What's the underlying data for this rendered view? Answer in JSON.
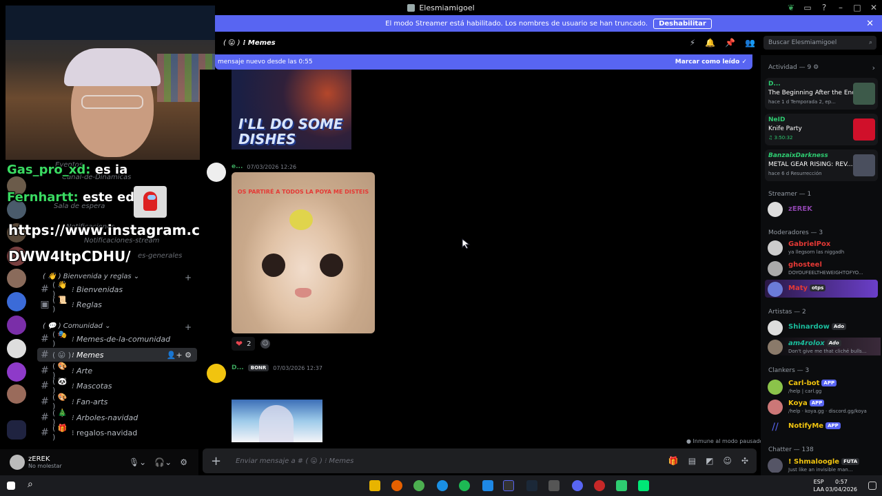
{
  "window": {
    "title": "Elesmiamigoel"
  },
  "banner": {
    "text": "El modo Streamer está habilitado. Los nombres de usuario se han truncado.",
    "button": "Deshabilitar"
  },
  "chat_header": {
    "channel_emoji": "( 😛 )",
    "channel_name": "⁝ Memes"
  },
  "search": {
    "placeholder": "Buscar Elesmiamigoel"
  },
  "newbar": {
    "text": "mensaje nuevo desde las 0:55",
    "mark_read": "Marcar como leído"
  },
  "overlay": {
    "line1_user": "Gas_pro_xd:",
    "line1_msg": " es ia",
    "line2_user": "Fernhartt:",
    "line2_msg": " este edit",
    "line3": "https://www.instagram.com/p/",
    "line4": "DWW4ItpCDHU/"
  },
  "sidebar": {
    "faded": [
      {
        "label": "Eventos"
      },
      {
        "label": "Canal-de-Dinamicas"
      },
      {
        "label": "Sala de espera"
      },
      {
        "label": "Notificaciones"
      },
      {
        "label": "Notificaciones-stream"
      },
      {
        "label": "es-generales"
      }
    ],
    "cat_bienvenida": "( 👋 ) Bienvenida y reglas ⌄",
    "cat_comunidad": "( 💬 ) Comunidad ⌄",
    "channels": [
      {
        "emoji": "( 👋 )",
        "label": "⁝ Bienvenidas"
      },
      {
        "emoji": "( 📜 )",
        "label": "⁝ Reglas"
      },
      {
        "emoji": "( 🎭 )",
        "label": "⁝ Memes-de-la-comunidad"
      },
      {
        "emoji": "( 😛 )",
        "label": "⁝ Memes"
      },
      {
        "emoji": "( 🎨 )",
        "label": "⁝ Arte"
      },
      {
        "emoji": "( 🐼 )",
        "label": "⁝ Mascotas"
      },
      {
        "emoji": "( 🎨 )",
        "label": "⁝ Fan-arts"
      },
      {
        "emoji": "( 🎄 )",
        "label": "⁝ Arboles-navidad"
      },
      {
        "emoji": "( 🎁 )",
        "label": "⁝ regalos-navidad"
      }
    ]
  },
  "user_panel": {
    "name": "zEREK",
    "status": "No molestar"
  },
  "messages": {
    "img1_caption": "I'LL DO SOME DISHES",
    "msg2_user": "e...",
    "msg2_time": "07/03/2026 12:26",
    "cat_caption": "OS PARTIRÉ A TODOS LA POYA ME DISTEIS",
    "reaction_count": "2",
    "msg3_user": "D...",
    "msg3_tag": "BONR",
    "msg3_time": "07/03/2026 12:37",
    "paused": "Inmune al modo pausado"
  },
  "input": {
    "placeholder": "Enviar mensaje a # ( 😛 ) ⁝ Memes"
  },
  "members": {
    "activity_header": "Actividad — 9",
    "activities": [
      {
        "name": "D...",
        "title": "The Beginning After the End",
        "sub": "hace 1 d   Temporada 2, ep...",
        "color": "#2ecc71"
      },
      {
        "name": "NeID",
        "title": "Knife Party",
        "sub": "♫ 3:50:32",
        "color": "#2ecc71"
      },
      {
        "name": "BanzaixDarkness",
        "title": "METAL GEAR RISING: REV...",
        "sub": "hace 6 d   Resurrección",
        "color": "#2ecc71"
      }
    ],
    "streamer_header": "Streamer — 1",
    "streamer": "zEREK",
    "mods_header": "Moderadores — 3",
    "mods": [
      {
        "name": "GabrielPox",
        "status": "ya llegsorn las niggadh",
        "color": "#e53935"
      },
      {
        "name": "ghosteel",
        "status": "DOYOUFEELTHEWEIGHTOFYO...",
        "color": "#e53935"
      },
      {
        "name": "Maty",
        "status": "otps",
        "color": "#e53935"
      }
    ],
    "artists_header": "Artistas — 2",
    "artists": [
      {
        "name": "Shinardow",
        "tag": "Ado",
        "status": "",
        "color": "#1abc9c"
      },
      {
        "name": "am4rolox",
        "tag": "Ado",
        "status": "Don't give me that cliché bulls...",
        "color": "#1abc9c"
      }
    ],
    "clankers_header": "Clankers — 3",
    "bots": [
      {
        "name": "Carl-bot",
        "tag": "APP",
        "status": "/help | carl.gg",
        "color": "#f1c40f"
      },
      {
        "name": "Koya",
        "tag": "APP",
        "status": "/help · koya.gg · discord.gg/koya",
        "color": "#f1c40f"
      },
      {
        "name": "NotifyMe",
        "tag": "APP",
        "status": "",
        "color": "#f1c40f"
      }
    ],
    "chatter_header": "Chatter — 138",
    "chatter": [
      {
        "name": "! Shmaloogle",
        "tag": "FUTA",
        "status": "Just like an invisible man...",
        "color": "#f1c40f"
      }
    ]
  },
  "taskbar": {
    "lang": "ESP",
    "lang2": "LAA",
    "time": "0:57",
    "date": "03/04/2026"
  }
}
